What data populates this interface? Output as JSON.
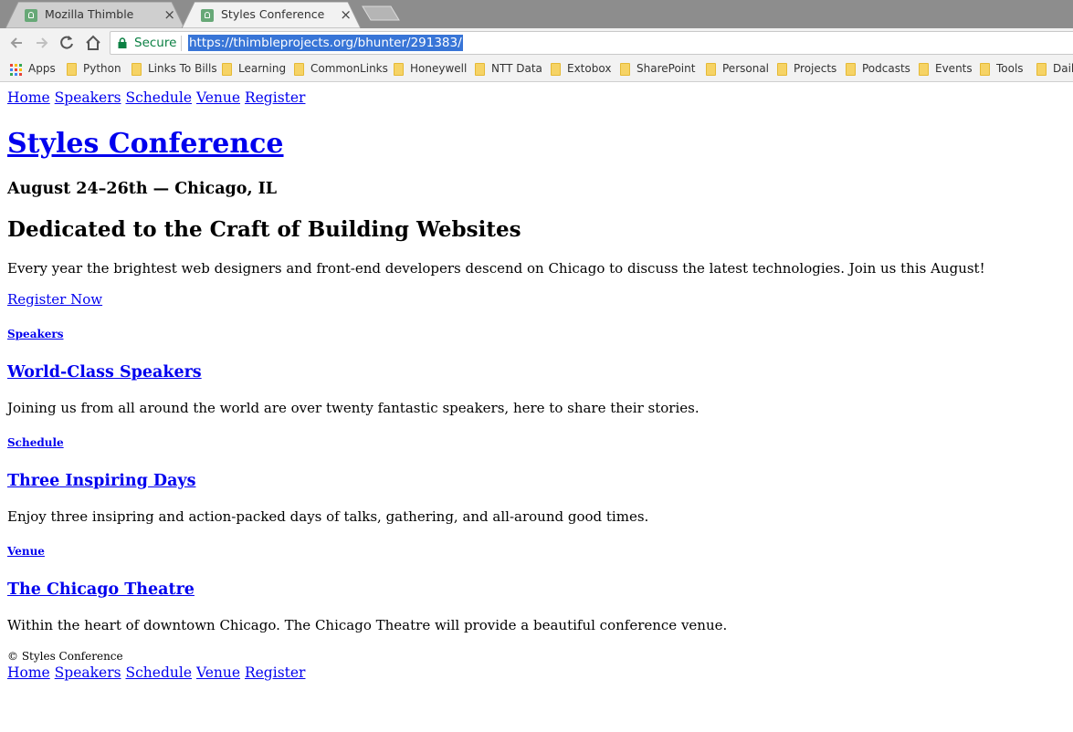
{
  "browser": {
    "tabs": [
      {
        "title": "Mozilla Thimble"
      },
      {
        "title": "Styles Conference"
      }
    ],
    "close_glyph": "×",
    "secure_label": "Secure",
    "url": "https://thimbleprojects.org/bhunter/291383/",
    "bookmarks": [
      {
        "label": "Apps",
        "icon": "apps-grid-icon"
      },
      {
        "label": "Python",
        "icon": "folder-icon"
      },
      {
        "label": "Links To Bills",
        "icon": "folder-icon"
      },
      {
        "label": "Learning",
        "icon": "folder-icon"
      },
      {
        "label": "CommonLinks",
        "icon": "folder-icon"
      },
      {
        "label": "Honeywell",
        "icon": "folder-icon"
      },
      {
        "label": "NTT Data",
        "icon": "folder-icon"
      },
      {
        "label": "Extobox",
        "icon": "folder-icon"
      },
      {
        "label": "SharePoint",
        "icon": "folder-icon"
      },
      {
        "label": "Personal",
        "icon": "folder-icon"
      },
      {
        "label": "Projects",
        "icon": "folder-icon"
      },
      {
        "label": "Podcasts",
        "icon": "folder-icon"
      },
      {
        "label": "Events",
        "icon": "folder-icon"
      },
      {
        "label": "Tools",
        "icon": "folder-icon"
      },
      {
        "label": "Daily",
        "icon": "folder-icon"
      }
    ]
  },
  "page": {
    "nav": [
      "Home",
      "Speakers",
      "Schedule",
      "Venue",
      "Register"
    ],
    "title": "Styles Conference",
    "dates": "August 24–26th — Chicago, IL",
    "tagline": "Dedicated to the Craft of Building Websites",
    "intro": "Every year the brightest web designers and front-end developers descend on Chicago to discuss the latest technologies. Join us this August!",
    "register_cta": "Register Now",
    "sections": [
      {
        "label": "Speakers",
        "heading": "World-Class Speakers",
        "text": "Joining us from all around the world are over twenty fantastic speakers, here to share their stories."
      },
      {
        "label": "Schedule",
        "heading": "Three Inspiring Days",
        "text": "Enjoy three insipring and action-packed days of talks, gathering, and all-around good times."
      },
      {
        "label": "Venue",
        "heading": "The Chicago Theatre",
        "text": "Within the heart of downtown Chicago. The Chicago Theatre will provide a beautiful conference venue."
      }
    ],
    "copyright": "© Styles Conference",
    "footer_nav": [
      "Home",
      "Speakers",
      "Schedule",
      "Venue",
      "Register"
    ]
  },
  "colors": {
    "link": "#0000ee",
    "secure": "#0b8043",
    "url_highlight": "#3875d7"
  }
}
